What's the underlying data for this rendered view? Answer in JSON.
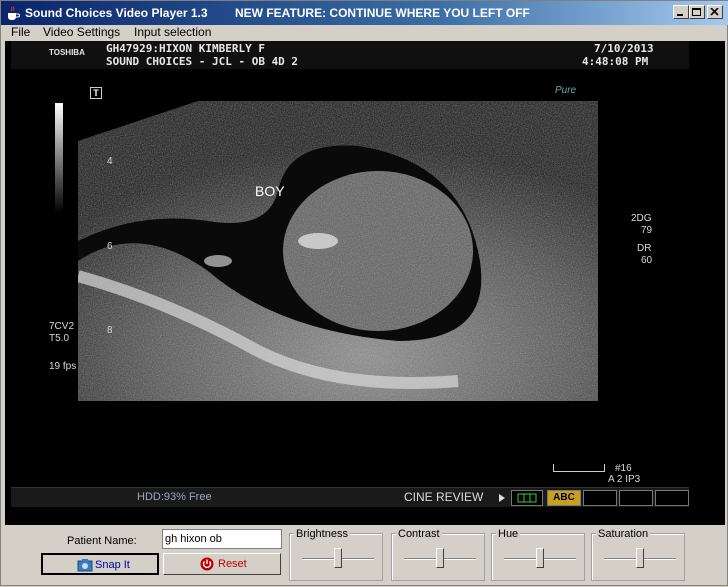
{
  "window": {
    "title": "Sound Choices Video Player 1.3",
    "feature_notice": "NEW FEATURE:  CONTINUE WHERE YOU LEFT OFF"
  },
  "menu": [
    "File",
    "Video Settings",
    "Input selection"
  ],
  "ultrasound": {
    "brand": "TOSHIBA",
    "patient_line": "GH47929:HIXON KIMBERLY     F",
    "facility_line": "SOUND CHOICES           - JCL -   OB 4D 2",
    "date": "7/10/2013",
    "time": "4:48:08 PM",
    "logo": "Pure",
    "annotation": "BOY",
    "depth_labels": [
      "4",
      "6",
      "8"
    ],
    "mode": "2DG",
    "gain": "79",
    "dr_label": "DR",
    "dr_value": "60",
    "probe": "7CV2",
    "probe_setting": "T5.0",
    "fps": "19 fps",
    "frame": "#16",
    "preset": "A 2   IP3"
  },
  "status": {
    "hdd": "HDD:93% Free",
    "cine": "CINE REVIEW",
    "abc": "ABC"
  },
  "controls": {
    "patient_label": "Patient Name:",
    "patient_value": "gh hixon ob",
    "snap_label": "Snap It",
    "reset_label": "Reset",
    "sliders": [
      {
        "label": "Brightness",
        "value": 0.5
      },
      {
        "label": "Contrast",
        "value": 0.5
      },
      {
        "label": "Hue",
        "value": 0.5
      },
      {
        "label": "Saturation",
        "value": 0.5
      }
    ]
  }
}
